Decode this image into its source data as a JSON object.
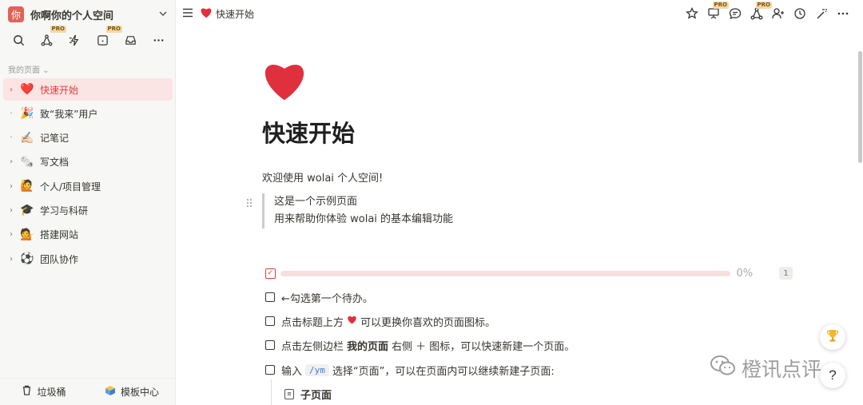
{
  "workspace": {
    "avatar_text": "你",
    "name": "你啊你的个人空间"
  },
  "sidebar": {
    "section_label": "我的页面 ⌄",
    "items": [
      {
        "label": "快速开始",
        "emoji": "❤️",
        "arrow": "›",
        "active": true
      },
      {
        "label": "致“我来”用户",
        "emoji": "🎉",
        "arrow": "·"
      },
      {
        "label": "记笔记",
        "emoji": "✍🏻",
        "arrow": "·"
      },
      {
        "label": "写文档",
        "emoji": "🗞️",
        "arrow": "›"
      },
      {
        "label": "个人/项目管理",
        "emoji": "🙋",
        "arrow": "›"
      },
      {
        "label": "学习与科研",
        "emoji": "🎓",
        "arrow": "›"
      },
      {
        "label": "搭建网站",
        "emoji": "💁",
        "arrow": "›"
      },
      {
        "label": "团队协作",
        "emoji": "⚽",
        "arrow": "›"
      }
    ],
    "pro_label": "PRO",
    "footer": {
      "trash_label": "垃圾桶",
      "templates_label": "模板中心"
    }
  },
  "topbar": {
    "breadcrumb": "快速开始"
  },
  "page": {
    "title": "快速开始",
    "welcome": "欢迎使用 wolai 个人空间!",
    "quote_line1": "这是一个示例页面",
    "quote_line2": "用来帮助你体验 wolai 的基本编辑功能",
    "progress": {
      "percent_text": "0%",
      "count": "1",
      "value": 0
    },
    "todos": {
      "t1": "←勾选第一个待办。",
      "t2_pre": "点击标题上方",
      "t2_post": "可以更换你喜欢的页面图标。",
      "t3_pre": "点击左侧边栏",
      "t3_bold": "我的页面",
      "t3_post": "右侧 ＋ 图标，可以快速新建一个页面。",
      "t4_pre": "输入",
      "t4_code": "/ym",
      "t4_post": "选择“页面”，可以在页面内可以继续新建子页面:"
    },
    "subpage_label": "子页面"
  },
  "watermark": {
    "text": "橙讯点评"
  },
  "colors": {
    "accent": "#e03e3e",
    "active_bg": "#fbe4e4",
    "sidebar_bg": "#f7f7f5"
  }
}
